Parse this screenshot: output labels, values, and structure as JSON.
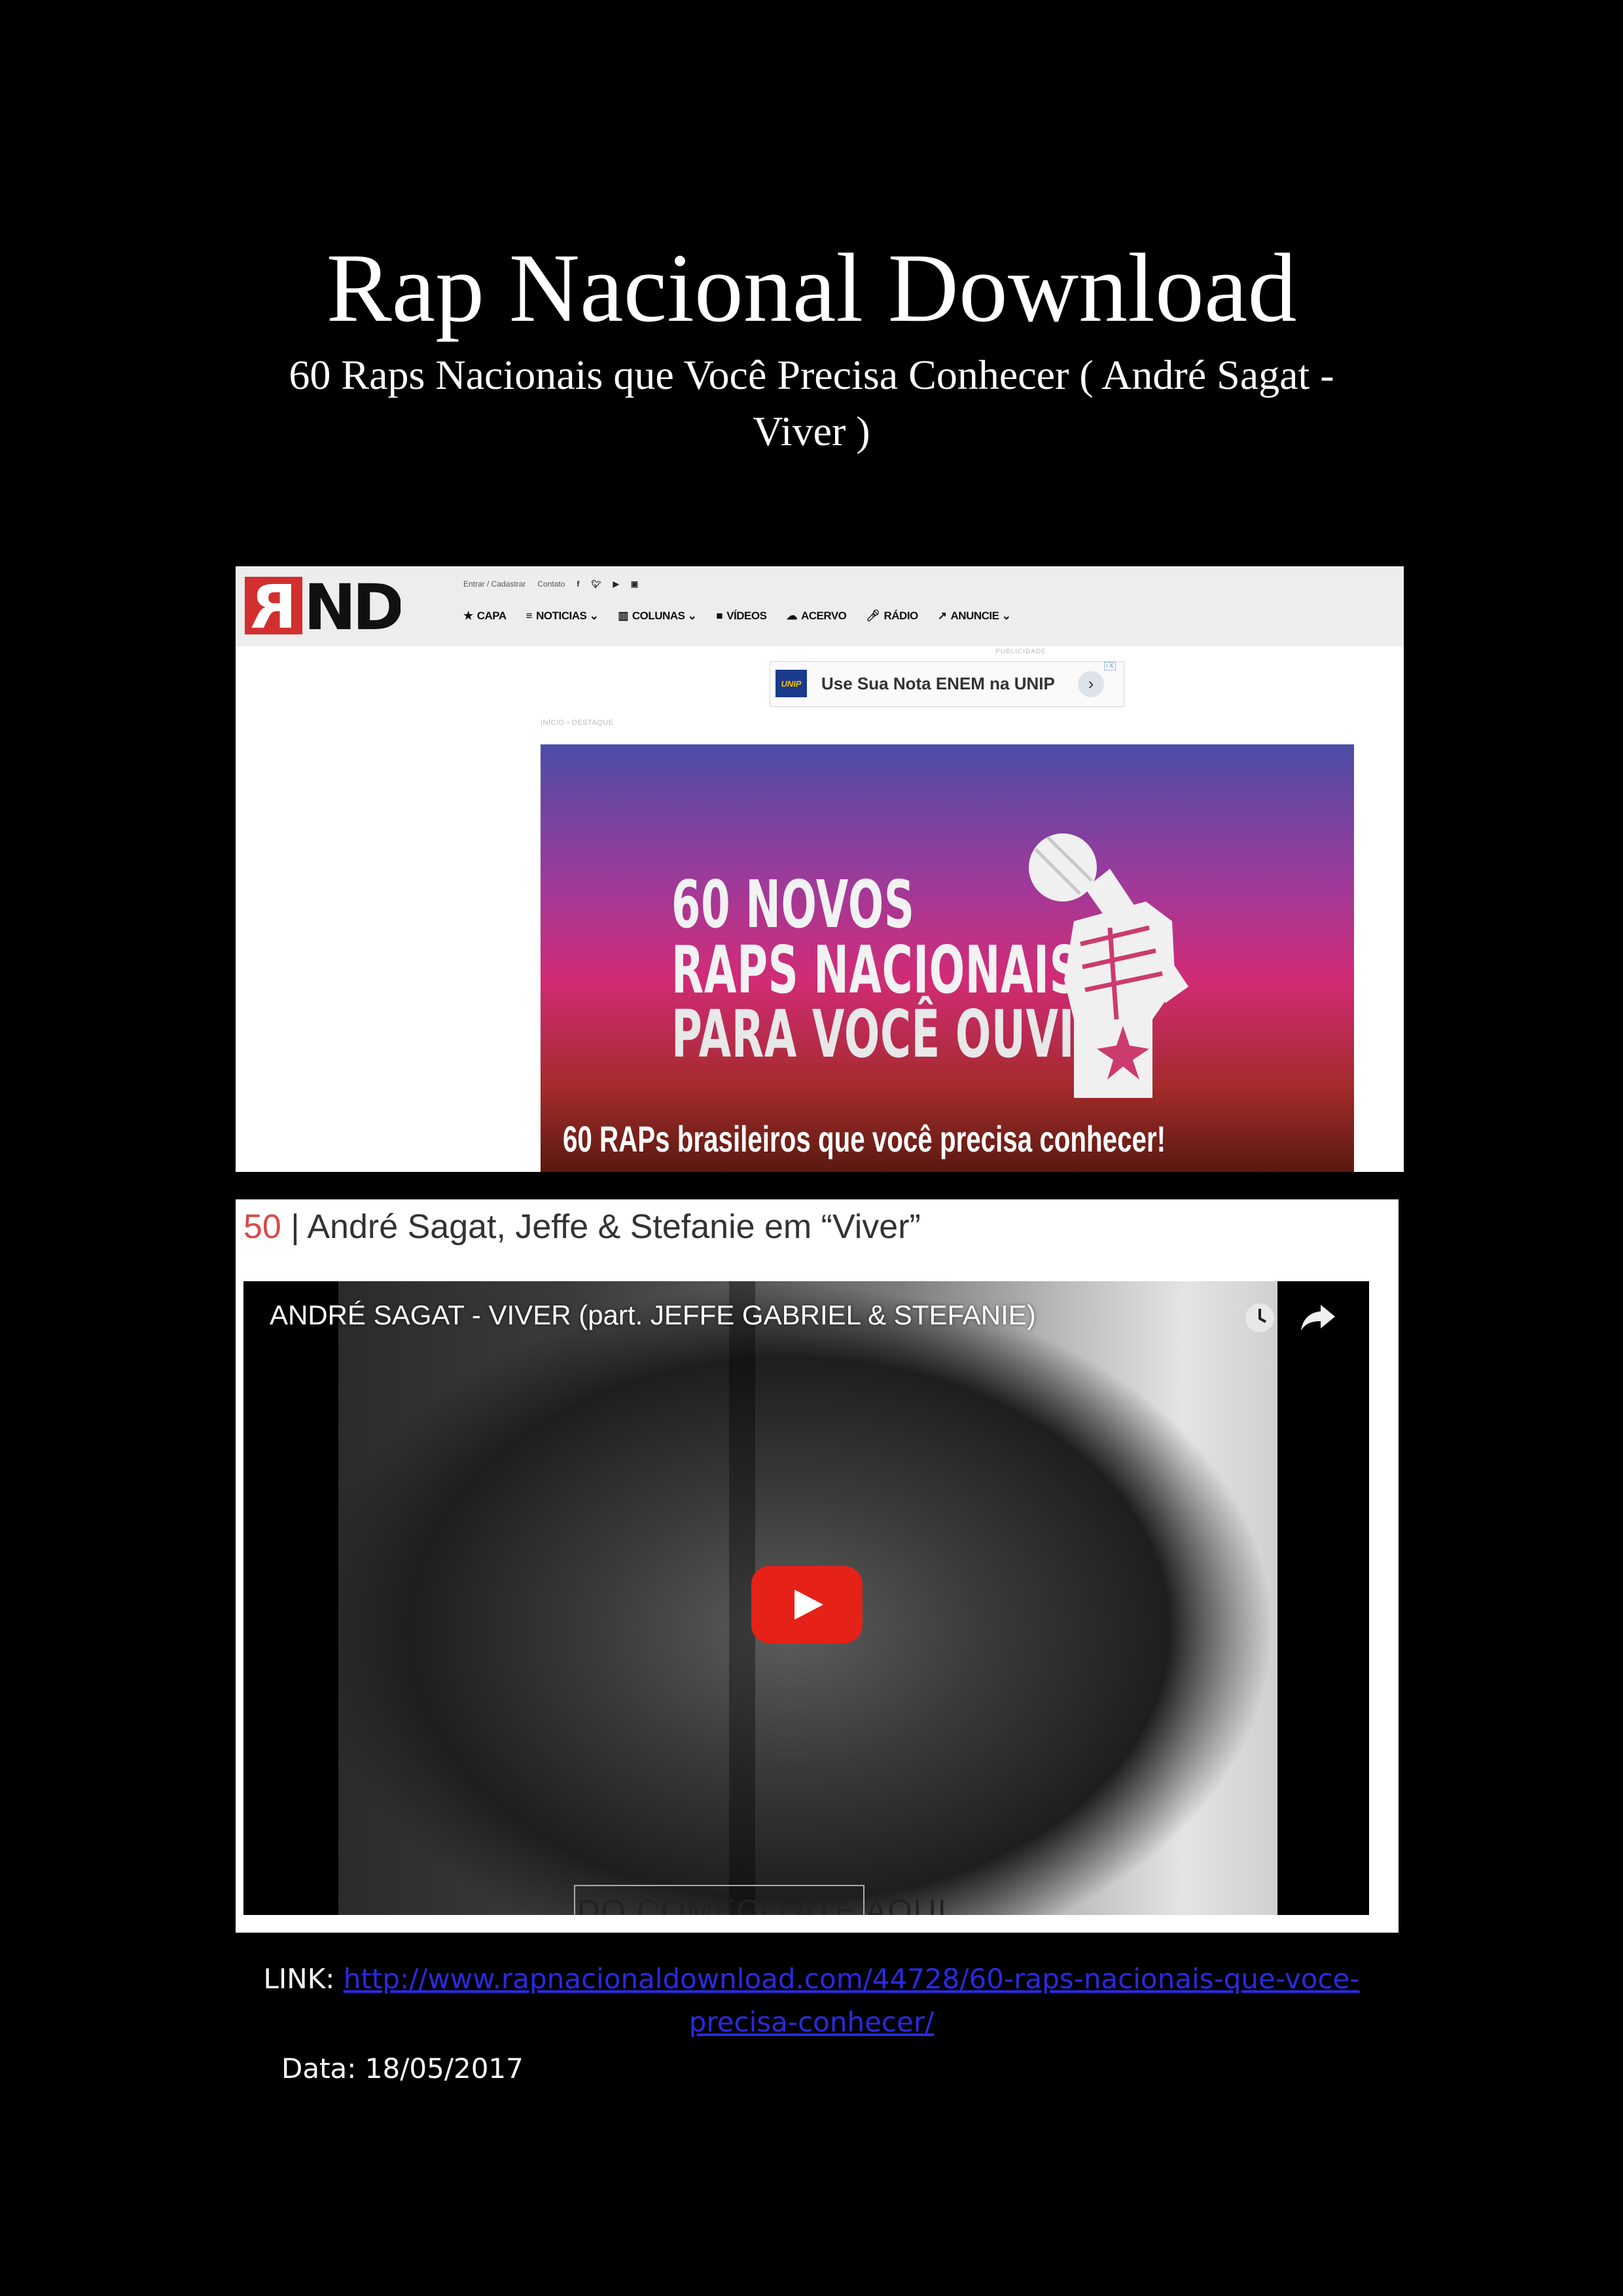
{
  "document": {
    "title": "Rap Nacional Download",
    "subtitle": "60 Raps Nacionais que Você Precisa Conhecer ( André Sagat - Viver )"
  },
  "site_screenshot": {
    "top_links": [
      "Entrar / Cadastrar",
      "Contato"
    ],
    "social_icons": [
      "facebook-icon",
      "twitter-icon",
      "youtube-icon",
      "instagram-icon"
    ],
    "nav": [
      {
        "label": "CAPA",
        "icon": "star-icon"
      },
      {
        "label": "NOTICIAS",
        "icon": "list-icon"
      },
      {
        "label": "COLUNAS",
        "icon": "columns-icon"
      },
      {
        "label": "VÍDEOS",
        "icon": "video-camera-icon"
      },
      {
        "label": "ACERVO",
        "icon": "cloud-download-icon"
      },
      {
        "label": "RÁDIO",
        "icon": "microphone-icon"
      },
      {
        "label": "ANUNCIE",
        "icon": "chart-icon"
      }
    ],
    "ad": {
      "label": "PUBLICIDADE",
      "brand": "UNIP",
      "text": "Use Sua Nota ENEM na UNIP",
      "choice": "i X"
    },
    "breadcrumb": "INÍCIO › DESTAQUE",
    "banner": {
      "line1": "60 NOVOS",
      "line2": "RAPS NACIONAIS",
      "line3": "PARA VOCÊ OUVIR!",
      "caption": "60 RAPs brasileiros que você precisa conhecer!"
    },
    "colors": {
      "accent": "#d32f2f",
      "banner_top": "#4b4da6",
      "banner_mid": "#d22b76",
      "banner_bottom": "#5a1a10"
    }
  },
  "video_screenshot": {
    "entry_number": "50",
    "entry_title": " | André Sagat, Jeffe & Stefanie em “Viver”",
    "video_title": "ANDRÉ SAGAT - VIVER (part. JEFFE GABRIEL & STEFANIE)",
    "frame_text": "DO COMEÇO ATÉ AQUI",
    "colors": {
      "play_button": "#e62117",
      "number": "#d94a4a"
    }
  },
  "footer": {
    "link_label": "LINK: ",
    "link_url": "http://www.rapnacionaldownload.com/44728/60-raps-nacionais-que-voce-precisa-conhecer/",
    "date": "Data: 18/05/2017"
  }
}
